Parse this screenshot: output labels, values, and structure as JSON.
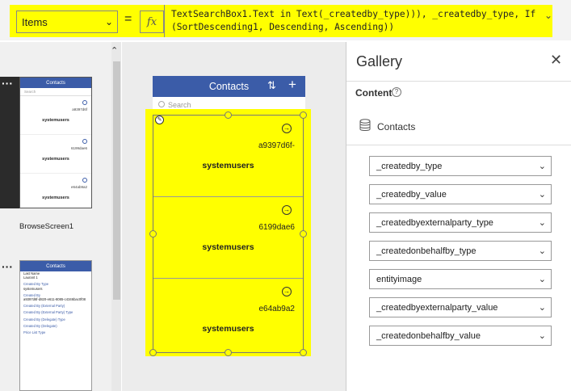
{
  "formula_bar": {
    "property": "Items",
    "equals": "=",
    "fx": "fx",
    "formula": "TextSearchBox1.Text in Text(_createdby_type))), _createdby_type, If\n(SortDescending1, Descending, Ascending))"
  },
  "screens": {
    "screen1": {
      "label": "BrowseScreen1",
      "header": "Contacts",
      "search": "Search",
      "items": [
        {
          "id": "a9397d6f",
          "name": "systemusers"
        },
        {
          "id": "6199dae6",
          "name": "systemusers"
        },
        {
          "id": "e64ab9a2",
          "name": "systemusers"
        }
      ]
    },
    "screen2": {
      "header": "Contacts",
      "lines": [
        {
          "text": "Last Name",
          "label": false
        },
        {
          "text": "Laurant 1",
          "label": false
        },
        {
          "text": "Created By Type",
          "label": true
        },
        {
          "text": "systemusers",
          "label": false
        },
        {
          "text": "Created By",
          "label": true
        },
        {
          "text": "a9397d6f-d820-e611-8085-c4346bac0f08",
          "label": false
        },
        {
          "text": "Created By (External Party)",
          "label": true
        },
        {
          "text": "Created By (External Party) Type",
          "label": true
        },
        {
          "text": "Created By (Delegate) Type",
          "label": true
        },
        {
          "text": "Created By (Delegate)",
          "label": true
        },
        {
          "text": "Price List Type",
          "label": true
        }
      ]
    }
  },
  "canvas": {
    "header_title": "Contacts",
    "search_placeholder": "Search",
    "gallery_items": [
      {
        "id": "a9397d6f-",
        "name": "systemusers"
      },
      {
        "id": "6199dae6",
        "name": "systemusers"
      },
      {
        "id": "e64ab9a2",
        "name": "systemusers"
      }
    ]
  },
  "properties_panel": {
    "title": "Gallery",
    "content_label": "Content",
    "data_source": "Contacts",
    "fields": [
      "_createdby_type",
      "_createdby_value",
      "_createdbyexternalparty_type",
      "_createdonbehalfby_type",
      "entityimage",
      "_createdbyexternalparty_value",
      "_createdonbehalfby_value"
    ]
  },
  "colors": {
    "highlight": "#ffff00",
    "app_header": "#3b5ca8"
  }
}
